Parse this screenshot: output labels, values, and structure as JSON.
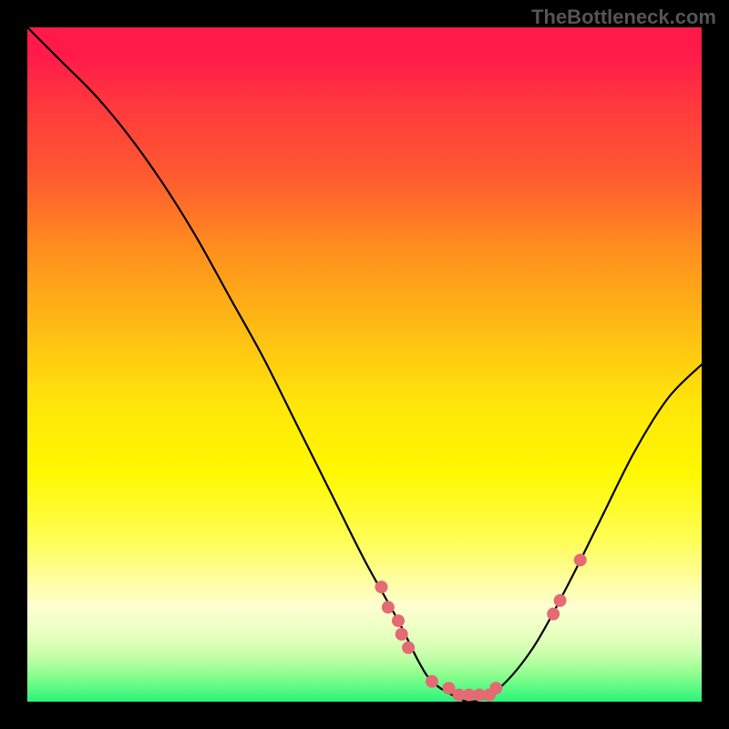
{
  "watermark": "TheBottleneck.com",
  "chart_data": {
    "type": "line",
    "title": "",
    "xlabel": "",
    "ylabel": "",
    "xlim": [
      0,
      100
    ],
    "ylim": [
      0,
      100
    ],
    "curve": {
      "x": [
        0,
        5,
        10,
        15,
        20,
        25,
        30,
        35,
        40,
        45,
        50,
        55,
        58,
        60,
        63,
        66,
        70,
        75,
        80,
        85,
        90,
        95,
        100
      ],
      "y": [
        100,
        95,
        90,
        84,
        77,
        69,
        60,
        51,
        41,
        31,
        21,
        12,
        6,
        3,
        1,
        0,
        2,
        8,
        17,
        27,
        37,
        45,
        50
      ]
    },
    "points": [
      {
        "x": 52.5,
        "y": 17
      },
      {
        "x": 53.5,
        "y": 14
      },
      {
        "x": 55.0,
        "y": 12
      },
      {
        "x": 55.5,
        "y": 10
      },
      {
        "x": 56.5,
        "y": 8
      },
      {
        "x": 60.0,
        "y": 3
      },
      {
        "x": 62.5,
        "y": 2
      },
      {
        "x": 64.0,
        "y": 1
      },
      {
        "x": 65.5,
        "y": 1
      },
      {
        "x": 67.0,
        "y": 1
      },
      {
        "x": 68.5,
        "y": 1
      },
      {
        "x": 69.5,
        "y": 2
      },
      {
        "x": 78.0,
        "y": 13
      },
      {
        "x": 79.0,
        "y": 15
      },
      {
        "x": 82.0,
        "y": 21
      }
    ],
    "point_color": "#e46a74",
    "curve_color": "#000000"
  }
}
